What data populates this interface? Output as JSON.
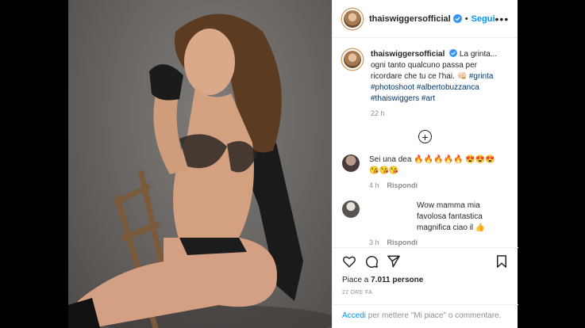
{
  "colors": {
    "accent": "#0095f6",
    "text": "#262626",
    "muted": "#8e8e8e",
    "hashtag": "#00376b"
  },
  "header": {
    "username": "thaiswiggersofficial",
    "separator": "•",
    "follow_label": "Segui",
    "more_label": "•••"
  },
  "caption": {
    "username": "thaiswiggersofficial",
    "text": "La grinta... ogni tanto qualcuno passa per ricordare che tu ce l'hai. 👊🏻",
    "hashtags": "#grinta #photoshoot #albertobuzzanca #thaiswiggers #art",
    "time": "22 h"
  },
  "load_more_icon": "plus-circle-icon",
  "comments": [
    {
      "text": "Sei una dea 🔥🔥🔥🔥🔥 😍😍😍😘😘😘",
      "time": "4 h",
      "reply_label": "Rispondi"
    },
    {
      "text": "Wow mamma mia favolosa fantastica magnifica ciao il 👍",
      "time": "3 h",
      "reply_label": "Rispondi"
    }
  ],
  "likes": {
    "prefix": "Piace a ",
    "count": "7.011 persone"
  },
  "posted_ago": "22 ORE FA",
  "add_comment": {
    "link": "Accedi",
    "rest": " per mettere \"Mi piace\" o commentare."
  }
}
